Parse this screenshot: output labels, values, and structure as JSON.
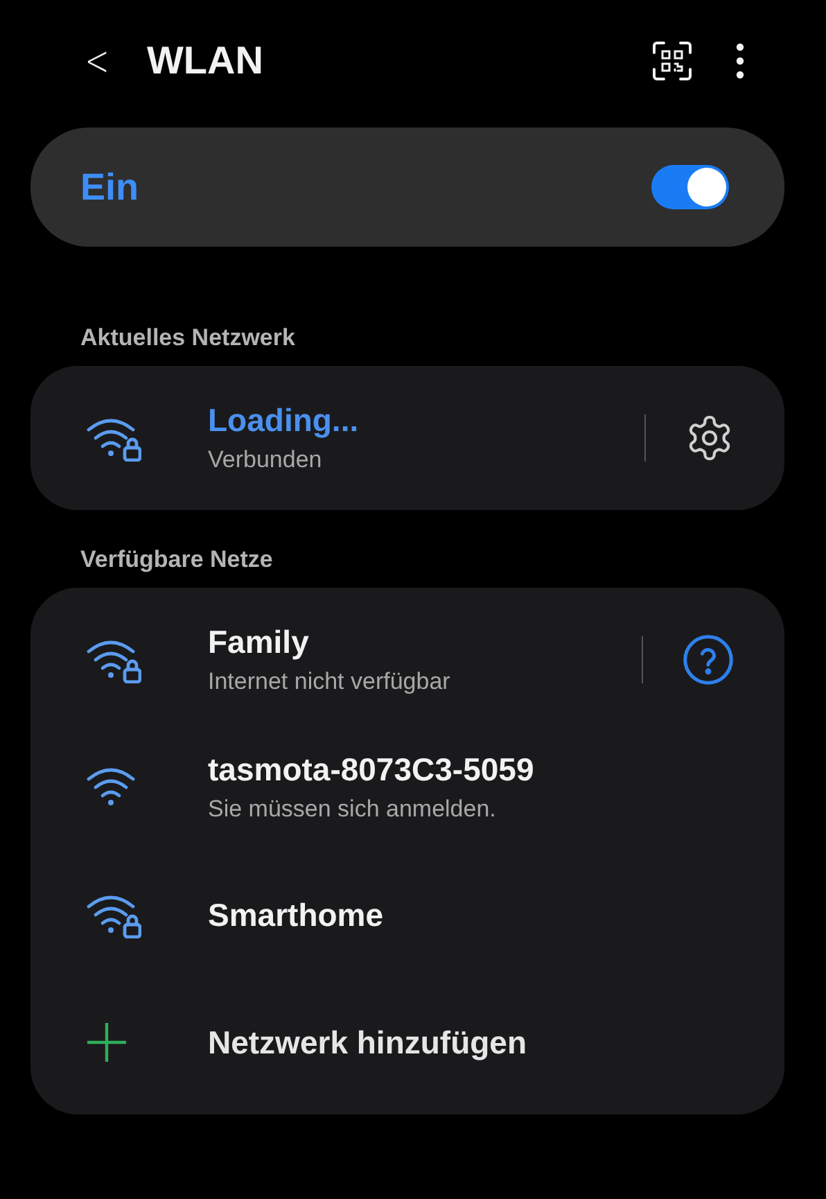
{
  "header": {
    "back": "<",
    "title": "WLAN"
  },
  "master": {
    "label": "Ein",
    "on": true
  },
  "current": {
    "heading": "Aktuelles Netzwerk",
    "networks": [
      {
        "kind": "network",
        "name": "Loading...",
        "subtitle": "Verbunden",
        "locked": true,
        "connected": true,
        "action": {
          "kind": "settings"
        }
      }
    ]
  },
  "available": {
    "heading": "Verfügbare Netze",
    "networks": [
      {
        "kind": "network",
        "name": "Family",
        "subtitle": "Internet nicht verfügbar",
        "locked": true,
        "connected": false,
        "action": {
          "kind": "help"
        }
      },
      {
        "kind": "network",
        "name": "tasmota-8073C3-5059",
        "subtitle": "Sie müssen sich anmelden.",
        "locked": false,
        "connected": false
      },
      {
        "kind": "network",
        "name": "Smarthome",
        "locked": true,
        "connected": false
      },
      {
        "kind": "add",
        "name": "Netzwerk hinzufügen"
      }
    ]
  }
}
